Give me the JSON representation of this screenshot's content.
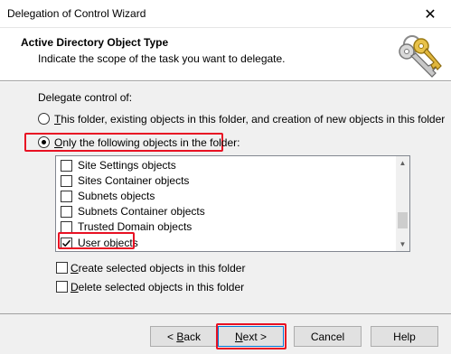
{
  "window": {
    "title": "Delegation of Control Wizard",
    "close_glyph": "✕"
  },
  "header": {
    "title": "Active Directory Object Type",
    "subtitle": "Indicate the scope of the task you want to delegate."
  },
  "body": {
    "delegate_label": "Delegate control of:",
    "radio_this_folder": {
      "mnemonic": "T",
      "rest": "his folder, existing objects in this folder, and creation of new objects in this folder",
      "selected": false
    },
    "radio_only_following": {
      "mnemonic": "O",
      "rest": "nly the following objects in the folder:",
      "selected": true
    },
    "objects": [
      {
        "label": "Site Settings objects",
        "checked": false
      },
      {
        "label": "Sites Container objects",
        "checked": false
      },
      {
        "label": "Subnets objects",
        "checked": false
      },
      {
        "label": "Subnets Container objects",
        "checked": false
      },
      {
        "label": "Trusted Domain objects",
        "checked": false
      },
      {
        "label": "User objects",
        "checked": true
      }
    ],
    "create_selected": {
      "mnemonic": "C",
      "rest": "reate selected objects in this folder",
      "checked": false
    },
    "delete_selected": {
      "mnemonic": "D",
      "rest": "elete selected objects in this folder",
      "checked": false
    }
  },
  "footer": {
    "back": {
      "prefix": "< ",
      "mnemonic": "B",
      "rest": "ack"
    },
    "next": {
      "mnemonic": "N",
      "rest": "ext >"
    },
    "cancel": "Cancel",
    "help": "Help"
  },
  "colors": {
    "highlight_red": "#e81123",
    "dialog_bg": "#f0f0f0",
    "accent_blue": "#0078d7"
  }
}
